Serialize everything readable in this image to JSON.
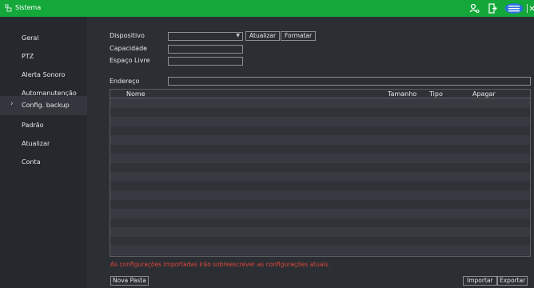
{
  "header": {
    "title": "Sistema"
  },
  "sidebar": {
    "items": [
      {
        "label": "Geral"
      },
      {
        "label": "PTZ"
      },
      {
        "label": "Alerta Sonoro"
      },
      {
        "label": "Automanutenção"
      },
      {
        "label": "Config. backup",
        "active": true
      },
      {
        "label": "Padrão"
      },
      {
        "label": "Atualizar"
      },
      {
        "label": "Conta"
      }
    ]
  },
  "form": {
    "device_label": "Dispositivo",
    "device_value": "",
    "refresh_label": "Atualizar",
    "format_label": "Formatar",
    "capacity_label": "Capacidade",
    "capacity_value": "",
    "free_label": "Espaço Livre",
    "free_value": "",
    "address_label": "Endereço",
    "address_value": ""
  },
  "table": {
    "columns": [
      "Nome",
      "Tamanho",
      "Tipo",
      "Apagar"
    ]
  },
  "warning": "As configurações importadas irão sobreescrever as configurações atuais.",
  "buttons": {
    "new_folder": "Nova Pasta",
    "import": "Importar",
    "export": "Exportar"
  },
  "colors": {
    "accent": "#14a83b",
    "warning": "#e0473b"
  }
}
